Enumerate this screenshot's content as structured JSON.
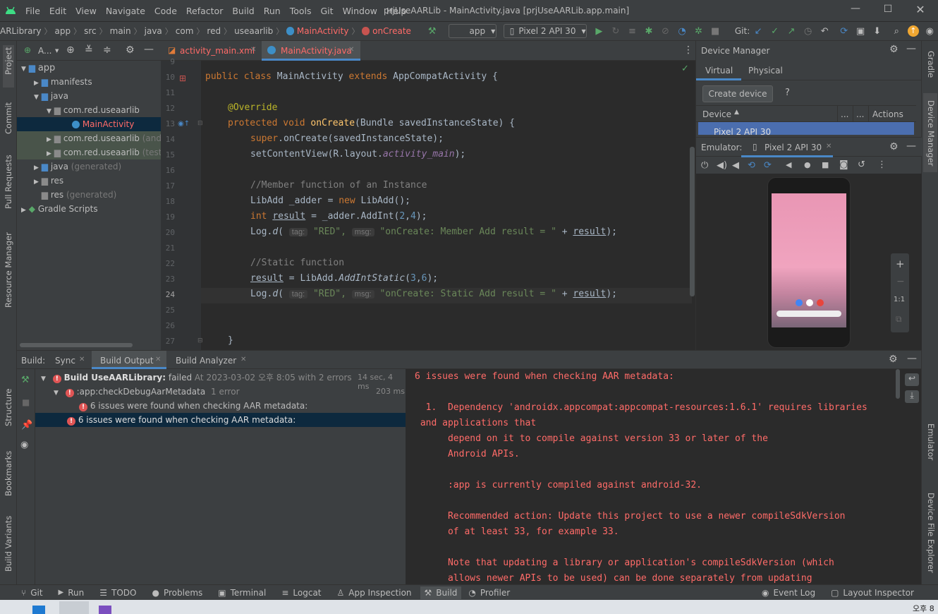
{
  "window": {
    "title": "prjUseAARLib - MainActivity.java [prjUseAARLib.app.main]",
    "menu": [
      "File",
      "Edit",
      "View",
      "Navigate",
      "Code",
      "Refactor",
      "Build",
      "Run",
      "Tools",
      "Git",
      "Window",
      "Help"
    ]
  },
  "navbar": {
    "breadcrumbs": [
      "ARLibrary",
      "app",
      "src",
      "main",
      "java",
      "com",
      "red",
      "useaarlib",
      "MainActivity",
      "onCreate"
    ],
    "run_config": "app",
    "device": "Pixel 2 API 30",
    "git_label": "Git:"
  },
  "left_strip": [
    "Project",
    "Commit",
    "Pull Requests",
    "Resource Manager",
    "Structure",
    "Bookmarks",
    "Build Variants"
  ],
  "right_strip": [
    "Gradle",
    "Device Manager",
    "Emulator",
    "Device File Explorer"
  ],
  "project": {
    "header": "A...",
    "tree": [
      {
        "label": "app",
        "suffix": ""
      },
      {
        "label": "manifests",
        "suffix": ""
      },
      {
        "label": "java",
        "suffix": ""
      },
      {
        "label": "com.red.useaarlib",
        "suffix": ""
      },
      {
        "label": "MainActivity",
        "suffix": ""
      },
      {
        "label": "com.red.useaarlib",
        "suffix": "(andr"
      },
      {
        "label": "com.red.useaarlib",
        "suffix": "(test)"
      },
      {
        "label": "java",
        "suffix": "(generated)"
      },
      {
        "label": "res",
        "suffix": ""
      },
      {
        "label": "res",
        "suffix": "(generated)"
      },
      {
        "label": "Gradle Scripts",
        "suffix": ""
      }
    ]
  },
  "editor": {
    "tabs": [
      "activity_main.xml",
      "MainActivity.java"
    ],
    "line_numbers": [
      "9",
      "10",
      "11",
      "12",
      "13",
      "14",
      "15",
      "16",
      "17",
      "18",
      "19",
      "20",
      "21",
      "22",
      "23",
      "24",
      "25",
      "26",
      "27"
    ],
    "lines": {
      "l10": {
        "a": "public class ",
        "b": "MainActivity ",
        "c": "extends ",
        "d": "AppCompatActivity {"
      },
      "l12": "@Override",
      "l13": {
        "a": "protected void ",
        "b": "onCreate",
        "c": "(Bundle savedInstanceState) {"
      },
      "l14": {
        "a": "super",
        "b": ".onCreate(savedInstanceState);"
      },
      "l15": {
        "a": "setContentView(R.layout.",
        "b": "activity_main",
        "c": ");"
      },
      "l17": "//Member function of an Instance",
      "l18": {
        "a": "LibAdd _adder = ",
        "b": "new ",
        "c": "LibAdd();"
      },
      "l19": {
        "a": "int ",
        "b": "result",
        "c": " = _adder.AddInt(",
        "d": "2",
        "e": ",",
        "f": "4",
        "g": ");"
      },
      "l20": {
        "a": "Log.",
        "b": "d",
        "c": "( ",
        "hint1": "tag:",
        "d": " \"RED\", ",
        "hint2": "msg:",
        "e": " \"onCreate: Member Add result = \"",
        "f": " + ",
        "g": "result",
        "h": ");"
      },
      "l22": "//Static function",
      "l23": {
        "a": "result",
        "b": " = LibAdd.",
        "c": "AddIntStatic",
        "d": "(",
        "e": "3",
        ",": ",",
        "f": "6",
        "g": ");"
      },
      "l24": {
        "a": "Log.",
        "b": "d",
        "c": "( ",
        "hint1": "tag:",
        "d": " \"RED\", ",
        "hint2": "msg:",
        "e": " \"onCreate: Static Add result = \"",
        "f": " + ",
        "g": "result",
        "h": ");"
      },
      "l27": "}"
    }
  },
  "device_manager": {
    "title": "Device Manager",
    "tabs": [
      "Virtual",
      "Physical"
    ],
    "create_button": "Create device",
    "help": "?",
    "col_device": "Device",
    "col_dots1": "...",
    "col_dots2": "...",
    "col_actions": "Actions",
    "row_device": "Pixel 2 API 30",
    "emulator_label": "Emulator:",
    "emulator_tab": "Pixel 2 API 30",
    "zoom_plus": "+",
    "zoom_minus": "−",
    "zoom_ratio": "1:1"
  },
  "build": {
    "label": "Build:",
    "tabs": [
      "Sync",
      "Build Output",
      "Build Analyzer"
    ],
    "tree": {
      "root_title": "Build UseAARLibrary:",
      "root_status": "failed",
      "root_meta": "At 2023-03-02 오후 8:05 with 2 errors",
      "root_time": "14 sec, 4 ms",
      "task": ":app:checkDebugAarMetadata",
      "task_meta": "1 error",
      "task_time": "203 ms",
      "issue1": "6 issues were found when checking AAR metadata:",
      "issue2": "6 issues were found when checking AAR metadata:"
    },
    "output": [
      "6 issues were found when checking AAR metadata:",
      "",
      "  1.  Dependency 'androidx.appcompat:appcompat-resources:1.6.1' requires libraries",
      " and applications that",
      "      depend on it to compile against version 33 or later of the",
      "      Android APIs.",
      "",
      "      :app is currently compiled against android-32.",
      "",
      "      Recommended action: Update this project to use a newer compileSdkVersion",
      "      of at least 33, for example 33.",
      "",
      "      Note that updating a library or application's compileSdkVersion (which",
      "      allows newer APIs to be used) can be done separately from updating"
    ]
  },
  "statusbar": {
    "items": [
      "Git",
      "Run",
      "TODO",
      "Problems",
      "Terminal",
      "Logcat",
      "App Inspection",
      "Build",
      "Profiler"
    ],
    "right": [
      "Event Log",
      "Layout Inspector"
    ]
  },
  "taskbar": {
    "clock": "오후 8"
  },
  "colors": {
    "accent": "#4a88c7",
    "error": "#ff6b68",
    "success": "#59a869",
    "selection": "#0d293e"
  }
}
